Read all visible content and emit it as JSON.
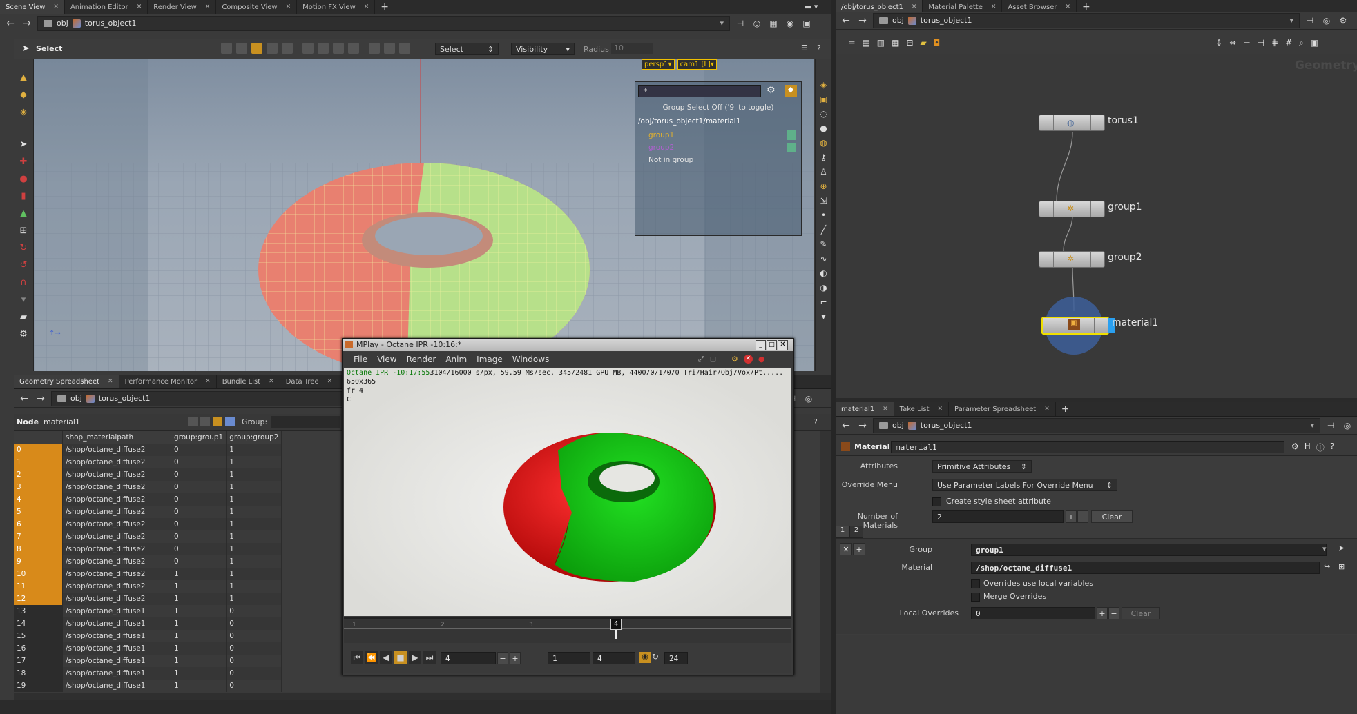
{
  "scene_tabs": [
    {
      "label": "Scene View",
      "active": true
    },
    {
      "label": "Animation Editor"
    },
    {
      "label": "Render View"
    },
    {
      "label": "Composite View"
    },
    {
      "label": "Motion FX View"
    }
  ],
  "scene_path": {
    "root": "obj",
    "object": "torus_object1"
  },
  "viewport_toolbar": {
    "tool": "Select",
    "select_mode": "Select",
    "visibility": "Visibility",
    "radius_label": "Radius",
    "radius_value": "10"
  },
  "viewport": {
    "camera1": "persp1▾",
    "camera2": "cam1 [L]▾"
  },
  "group_list": {
    "filter": "*",
    "toggle_hint": "Group Select Off ('9' to toggle)",
    "path": "/obj/torus_object1/material1",
    "items": [
      {
        "name": "group1",
        "color": "#e0b030"
      },
      {
        "name": "group2",
        "color": "#b060d0"
      },
      {
        "name": "Not in group",
        "color": "#e6e6e6"
      }
    ]
  },
  "spreadsheet_tabs": [
    {
      "label": "Geometry Spreadsheet",
      "active": true
    },
    {
      "label": "Performance Monitor"
    },
    {
      "label": "Bundle List"
    },
    {
      "label": "Data Tree"
    }
  ],
  "spreadsheet": {
    "path_root": "obj",
    "path_object": "torus_object1",
    "node_label": "Node",
    "node_value": "material1",
    "group_label": "Group:",
    "columns": [
      "",
      "shop_materialpath",
      "group:group1",
      "group:group2"
    ],
    "rows": [
      [
        "0",
        "/shop/octane_diffuse2",
        "0",
        "1"
      ],
      [
        "1",
        "/shop/octane_diffuse2",
        "0",
        "1"
      ],
      [
        "2",
        "/shop/octane_diffuse2",
        "0",
        "1"
      ],
      [
        "3",
        "/shop/octane_diffuse2",
        "0",
        "1"
      ],
      [
        "4",
        "/shop/octane_diffuse2",
        "0",
        "1"
      ],
      [
        "5",
        "/shop/octane_diffuse2",
        "0",
        "1"
      ],
      [
        "6",
        "/shop/octane_diffuse2",
        "0",
        "1"
      ],
      [
        "7",
        "/shop/octane_diffuse2",
        "0",
        "1"
      ],
      [
        "8",
        "/shop/octane_diffuse2",
        "0",
        "1"
      ],
      [
        "9",
        "/shop/octane_diffuse2",
        "0",
        "1"
      ],
      [
        "10",
        "/shop/octane_diffuse2",
        "1",
        "1"
      ],
      [
        "11",
        "/shop/octane_diffuse2",
        "1",
        "1"
      ],
      [
        "12",
        "/shop/octane_diffuse2",
        "1",
        "1"
      ],
      [
        "13",
        "/shop/octane_diffuse1",
        "1",
        "0"
      ],
      [
        "14",
        "/shop/octane_diffuse1",
        "1",
        "0"
      ],
      [
        "15",
        "/shop/octane_diffuse1",
        "1",
        "0"
      ],
      [
        "16",
        "/shop/octane_diffuse1",
        "1",
        "0"
      ],
      [
        "17",
        "/shop/octane_diffuse1",
        "1",
        "0"
      ],
      [
        "18",
        "/shop/octane_diffuse1",
        "1",
        "0"
      ],
      [
        "19",
        "/shop/octane_diffuse1",
        "1",
        "0"
      ]
    ],
    "highlight_rows_until": 12
  },
  "mplay": {
    "title": "MPlay - Octane IPR -10:16:*",
    "menu": [
      "File",
      "View",
      "Render",
      "Anim",
      "Image",
      "Windows"
    ],
    "status_green": "Octane IPR -10:17:55",
    "status_rest": "3104/16000 s/px, 59.59 Ms/sec, 345/2481 GPU MB, 4400/0/1/0/0 Tri/Hair/Obj/Vox/Pt.....",
    "resolution": "650x365",
    "frame_line": "fr 4",
    "channel": "C",
    "timeline_ticks": [
      "1",
      "2",
      "3"
    ],
    "current_frame": "4",
    "frame_field": "4",
    "range_start": "1",
    "range_end": "4",
    "fps": "24"
  },
  "network_tabs": [
    {
      "label": "/obj/torus_object1",
      "active": true
    },
    {
      "label": "Material Palette"
    },
    {
      "label": "Asset Browser"
    }
  ],
  "network": {
    "path_root": "obj",
    "path_object": "torus_object1",
    "context_label": "Geometry",
    "nodes": [
      {
        "name": "torus1"
      },
      {
        "name": "group1"
      },
      {
        "name": "group2"
      },
      {
        "name": "material1"
      }
    ]
  },
  "param_tabs": [
    {
      "label": "material1",
      "active": true
    },
    {
      "label": "Take List"
    },
    {
      "label": "Parameter Spreadsheet"
    }
  ],
  "params": {
    "path_root": "obj",
    "path_object": "torus_object1",
    "node_type": "Material",
    "node_name": "material1",
    "attributes_label": "Attributes",
    "attributes_value": "Primitive Attributes",
    "override_label": "Override Menu",
    "override_value": "Use Parameter Labels For Override Menu",
    "style_sheet_label": "Create style sheet attribute",
    "num_materials_label": "Number of Materials",
    "num_materials_value": "2",
    "clear_label": "Clear",
    "multi_tabs": [
      "1",
      "2"
    ],
    "group_label": "Group",
    "group_value": "group1",
    "material_label": "Material",
    "material_value": "/shop/octane_diffuse1",
    "local_vars_label": "Overrides use local variables",
    "merge_label": "Merge Overrides",
    "local_overrides_label": "Local Overrides",
    "local_overrides_value": "0",
    "clear2_label": "Clear"
  }
}
